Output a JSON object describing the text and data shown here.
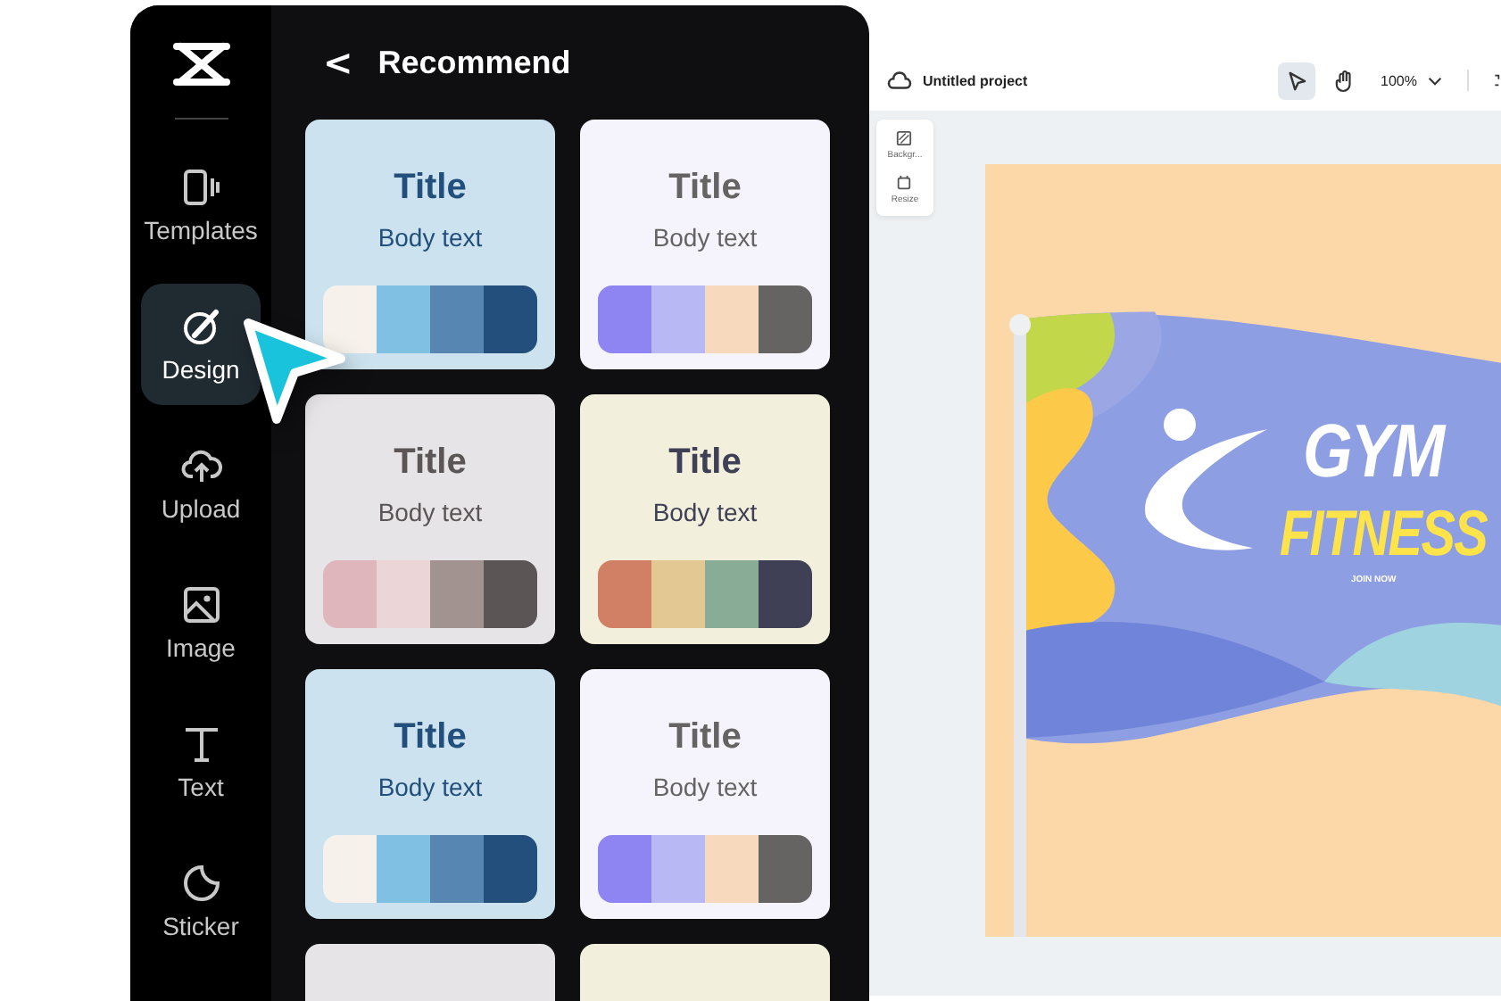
{
  "sidebar": {
    "items": [
      {
        "label": "Templates",
        "selected": false
      },
      {
        "label": "Design",
        "selected": true
      },
      {
        "label": "Upload",
        "selected": false
      },
      {
        "label": "Image",
        "selected": false
      },
      {
        "label": "Text",
        "selected": false
      },
      {
        "label": "Sticker",
        "selected": false
      }
    ]
  },
  "panel": {
    "back": "<",
    "title": "Recommend",
    "cards": [
      {
        "title": "Title",
        "body": "Body text",
        "color": "#cce3ef",
        "swatches": [
          {
            "color": "#f6f1ea"
          },
          {
            "color": "#80c0e3"
          },
          {
            "color": "#5886b2"
          },
          {
            "color": "#234f7c"
          }
        ]
      },
      {
        "title": "Title",
        "body": "Body text",
        "color": "#f5f4fc",
        "swatches": [
          {
            "color": "#8f85f2"
          },
          {
            "color": "#b7b8f4"
          },
          {
            "color": "#f7d9be"
          },
          {
            "color": "#666462"
          }
        ]
      },
      {
        "title": "Title",
        "body": "Body text",
        "color": "#e6e4e6",
        "swatches": [
          {
            "color": "#e0b6bd"
          },
          {
            "color": "#ecd5d6"
          },
          {
            "color": "#a29391"
          },
          {
            "color": "#5b5556"
          }
        ]
      },
      {
        "title": "Title",
        "body": "Body text",
        "color": "#f2f0dd",
        "swatches": [
          {
            "color": "#d17f65"
          },
          {
            "color": "#e3c893"
          },
          {
            "color": "#88ac96"
          },
          {
            "color": "#3f3f55"
          }
        ]
      },
      {
        "title": "Title",
        "body": "Body text",
        "color": "#cce3ef",
        "swatches": [
          {
            "color": "#f6f1ea"
          },
          {
            "color": "#80c0e3"
          },
          {
            "color": "#5886b2"
          },
          {
            "color": "#234f7c"
          }
        ]
      },
      {
        "title": "Title",
        "body": "Body text",
        "color": "#f5f4fc",
        "swatches": [
          {
            "color": "#8f85f2"
          },
          {
            "color": "#b7b8f4"
          },
          {
            "color": "#f7d9be"
          },
          {
            "color": "#666462"
          }
        ]
      },
      {
        "color": "#e6e4e6"
      },
      {
        "color": "#f2f0dd"
      }
    ]
  },
  "editor": {
    "project_title": "Untitled project",
    "tools": [
      {
        "selected": true
      },
      {
        "selected": false
      }
    ],
    "zoom": "100%",
    "side_tools": [
      {
        "label": "Backgr..."
      },
      {
        "label": "Resize"
      }
    ],
    "artboard": {
      "headline": "GYM",
      "subhead": "FITNESS",
      "tagline": "JOIN NOW"
    }
  }
}
